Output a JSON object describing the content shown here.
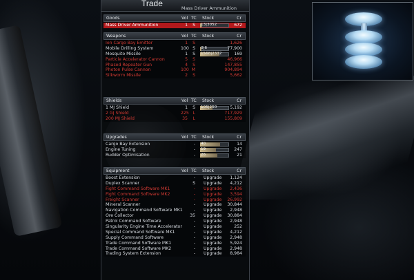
{
  "window": {
    "title": "Trade",
    "subtitle": "Mass Driver Ammunition"
  },
  "headers": {
    "vol": "Vol",
    "tc": "TC",
    "stock": "Stock",
    "cr": "Cr"
  },
  "goods": {
    "title": "Goods",
    "rows": [
      {
        "name": "Mass Driver Ammunition",
        "vol": "1",
        "tc": "S",
        "stock": "13|3052",
        "fill": 0.08,
        "cr": "672",
        "state": "selected"
      }
    ]
  },
  "weapons": {
    "title": "Weapons",
    "rows": [
      {
        "name": "Ion Cargo Bay Emitter",
        "vol": "1",
        "tc": "S",
        "stock": "",
        "fill": 0,
        "cr": "1,626",
        "state": "red"
      },
      {
        "name": "Mobile Drilling System",
        "vol": "100",
        "tc": "S",
        "stock": "0|6",
        "fill": 0.05,
        "cr": "77,900",
        "state": "normal"
      },
      {
        "name": "Mosquito Missile",
        "vol": "1",
        "tc": "S",
        "stock": "1568|2332",
        "fill": 0.67,
        "cr": "169",
        "state": "normal"
      },
      {
        "name": "Particle Accelerator Cannon",
        "vol": "5",
        "tc": "S",
        "stock": "",
        "fill": 0,
        "cr": "46,966",
        "state": "red"
      },
      {
        "name": "Phased Repeater Gun",
        "vol": "4",
        "tc": "S",
        "stock": "",
        "fill": 0,
        "cr": "147,855",
        "state": "red"
      },
      {
        "name": "Photon Pulse Cannon",
        "vol": "100",
        "tc": "M",
        "stock": "",
        "fill": 0,
        "cr": "904,894",
        "state": "red"
      },
      {
        "name": "Silkworm Missile",
        "vol": "2",
        "tc": "S",
        "stock": "",
        "fill": 0,
        "cr": "5,662",
        "state": "red"
      }
    ]
  },
  "shields": {
    "title": "Shields",
    "rows": [
      {
        "name": "1 MJ Shield",
        "vol": "1",
        "tc": "S",
        "stock": "105|250",
        "fill": 0.42,
        "cr": "5,192",
        "state": "normal"
      },
      {
        "name": "2 GJ Shield",
        "vol": "225",
        "tc": "L",
        "stock": "",
        "fill": 0,
        "cr": "717,929",
        "state": "red"
      },
      {
        "name": "200 MJ Shield",
        "vol": "35",
        "tc": "L",
        "stock": "",
        "fill": 0,
        "cr": "155,809",
        "state": "red"
      }
    ]
  },
  "upgrades": {
    "title": "Upgrades",
    "rows": [
      {
        "name": "Cargo Bay Extension",
        "vol": "",
        "tc": "-",
        "stock": "40",
        "fill": 0.7,
        "cr": "14",
        "state": "normal"
      },
      {
        "name": "Engine Tuning",
        "vol": "",
        "tc": "-",
        "stock": "19",
        "fill": 0.55,
        "cr": "247",
        "state": "normal"
      },
      {
        "name": "Rudder Optimisation",
        "vol": "",
        "tc": "-",
        "stock": "26",
        "fill": 0.6,
        "cr": "21",
        "state": "normal"
      }
    ]
  },
  "equipment": {
    "title": "Equipment",
    "rows": [
      {
        "name": "Boost Extension",
        "vol": "",
        "tc": "-",
        "stock": "Upgrade",
        "cr": "1,124",
        "state": "normal"
      },
      {
        "name": "Duplex Scanner",
        "vol": "",
        "tc": "S",
        "stock": "Upgrade",
        "cr": "4,212",
        "state": "normal"
      },
      {
        "name": "Fight Command Software MK1",
        "vol": "",
        "tc": "-",
        "stock": "Upgrade",
        "cr": "2,436",
        "state": "red"
      },
      {
        "name": "Fight Command Software MK2",
        "vol": "",
        "tc": "-",
        "stock": "Upgrade",
        "cr": "3,594",
        "state": "red"
      },
      {
        "name": "Freight Scanner",
        "vol": "",
        "tc": "-",
        "stock": "Upgrade",
        "cr": "26,992",
        "state": "red"
      },
      {
        "name": "Mineral Scanner",
        "vol": "",
        "tc": "-",
        "stock": "Upgrade",
        "cr": "30,844",
        "state": "normal"
      },
      {
        "name": "Navigation Command Software MK1",
        "vol": "",
        "tc": "-",
        "stock": "Upgrade",
        "cr": "2,948",
        "state": "normal"
      },
      {
        "name": "Ore Collector",
        "vol": "",
        "tc": "35",
        "stock": "Upgrade",
        "cr": "30,884",
        "state": "normal"
      },
      {
        "name": "Patrol Command Software",
        "vol": "",
        "tc": "-",
        "stock": "Upgrade",
        "cr": "2,948",
        "state": "normal"
      },
      {
        "name": "Singularity Engine Time Accelerator",
        "vol": "",
        "tc": "-",
        "stock": "Upgrade",
        "cr": "252",
        "state": "normal"
      },
      {
        "name": "Special Command Software MK1",
        "vol": "",
        "tc": "-",
        "stock": "Upgrade",
        "cr": "4,212",
        "state": "normal"
      },
      {
        "name": "Supply Command Software",
        "vol": "",
        "tc": "-",
        "stock": "Upgrade",
        "cr": "2,948",
        "state": "normal"
      },
      {
        "name": "Trade Command Software MK1",
        "vol": "",
        "tc": "-",
        "stock": "Upgrade",
        "cr": "5,924",
        "state": "normal"
      },
      {
        "name": "Trade Command Software MK2",
        "vol": "",
        "tc": "-",
        "stock": "Upgrade",
        "cr": "2,948",
        "state": "normal"
      },
      {
        "name": "Trading System Extension",
        "vol": "",
        "tc": "-",
        "stock": "Upgrade",
        "cr": "8,984",
        "state": "normal"
      }
    ]
  }
}
